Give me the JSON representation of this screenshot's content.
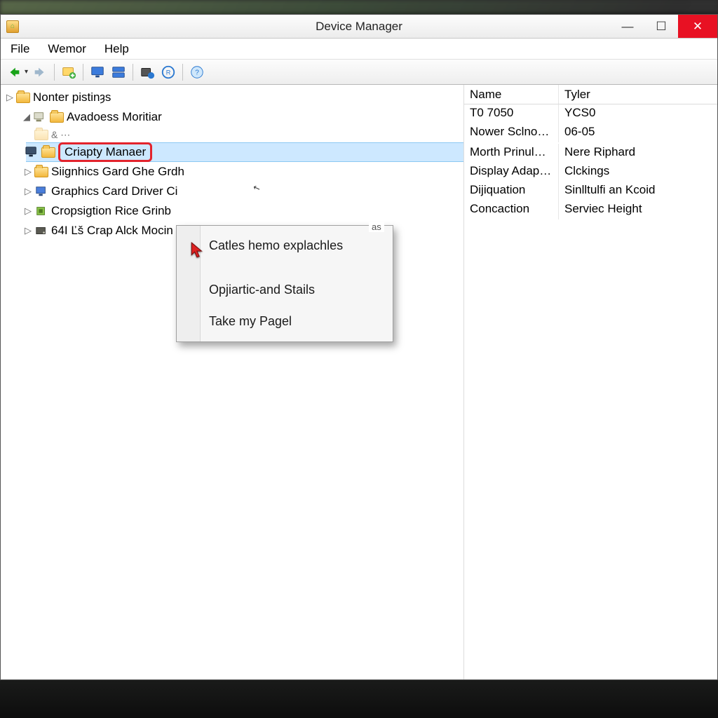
{
  "window": {
    "title": "Device Manager"
  },
  "menu": {
    "file": "File",
    "wemor": "Wemor",
    "help": "Help"
  },
  "tree": {
    "root": "Nonter pistinȝs",
    "item1": "Avadoess Moritiar",
    "item1a": "& ⋯",
    "selected": "Criapty Manaer",
    "item2": "Siignhics Gard Ghe Grdh",
    "item3": "Graphics Card Driver Ci",
    "item4": "Cropsigtion Rice Grinb",
    "item5": "64I Ľš Crap Alck Mocin"
  },
  "context_menu": {
    "tag": "as",
    "item1": "Catles hemo explachles",
    "item2": "Opjiartic-and Stails",
    "item3": "Take my Pagel"
  },
  "details": {
    "headers": {
      "name": "Name",
      "tyler": "Tyler"
    },
    "rows": [
      {
        "name": "T0 7050",
        "val": "YCS0"
      },
      {
        "name": "Nower Sclnoro…",
        "val": "06-05"
      },
      {
        "name": "Morth Prinule …",
        "val": "Nere Riphard"
      },
      {
        "name": "Display Adapters",
        "val": "Clckings"
      },
      {
        "name": "Dijiquation",
        "val": "Sinlltulfi an Kcoid"
      },
      {
        "name": "Concaction",
        "val": "Serviec Height"
      }
    ]
  }
}
